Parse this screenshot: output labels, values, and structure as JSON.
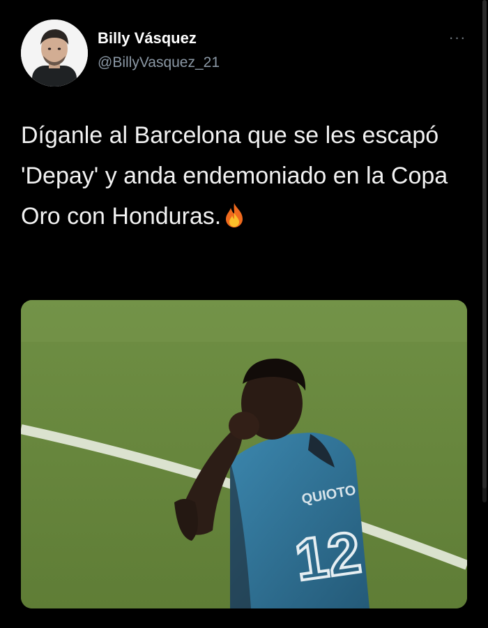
{
  "tweet": {
    "display_name": "Billy Vásquez",
    "handle": "@BillyVasquez_21",
    "text": "Díganle al Barcelona que se les escapó 'Depay' y anda endemoniado en la Copa Oro con Honduras.",
    "emoji": "🔥",
    "more_label": "···",
    "media": {
      "jersey_name": "QUIOTO",
      "jersey_number": "12"
    }
  },
  "colors": {
    "background": "#000000",
    "text": "#f2f2f2",
    "muted": "#8b98a5",
    "pitch": "#6a8a3e",
    "jersey": "#2f6f92"
  },
  "icons": {
    "more": "more-dots-icon",
    "emoji": "fire-icon"
  }
}
